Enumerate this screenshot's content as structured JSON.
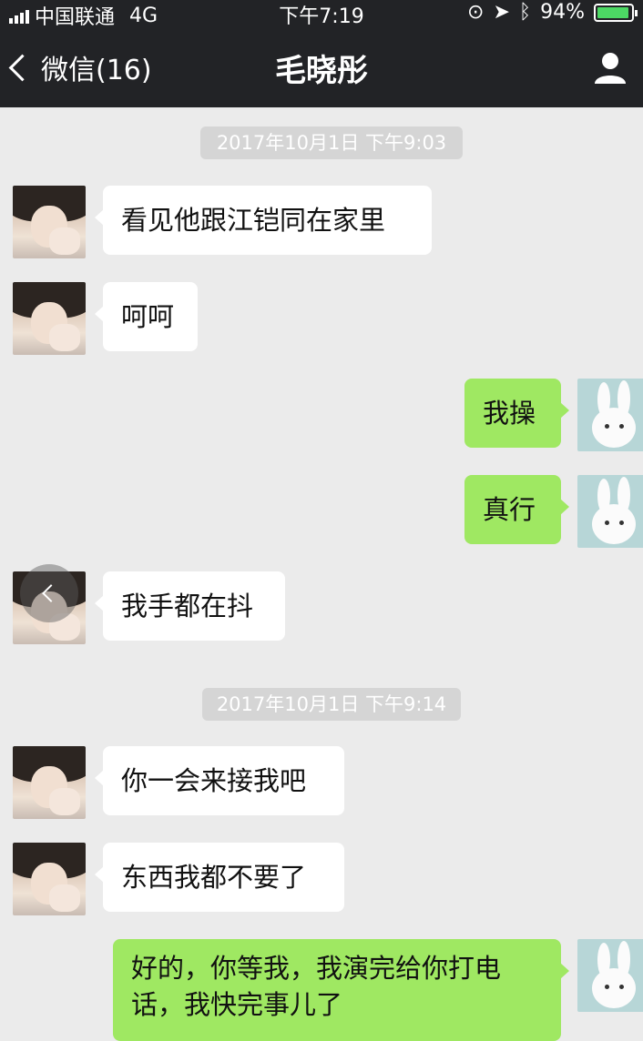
{
  "status_bar": {
    "carrier": "中国联通",
    "network": "4G",
    "time": "下午7:19",
    "battery_text": "94%",
    "battery_level": 0.94,
    "battery_color": "#4cd964"
  },
  "nav": {
    "back_label": "微信(16)",
    "title": "毛晓彤",
    "profile_icon": "person-icon"
  },
  "timestamps": [
    "2017年10月1日 下午9:03",
    "2017年10月1日 下午9:14"
  ],
  "messages": [
    {
      "sender": "contact",
      "text": "看见他跟江铠同在家里"
    },
    {
      "sender": "contact",
      "text": "呵呵"
    },
    {
      "sender": "me",
      "text": "我操"
    },
    {
      "sender": "me",
      "text": "真行"
    },
    {
      "sender": "contact",
      "text": "我手都在抖"
    },
    {
      "sender": "contact",
      "text": "你一会来接我吧"
    },
    {
      "sender": "contact",
      "text": "东西我都不要了"
    },
    {
      "sender": "me",
      "line1": "好的，你等我，我演完给你打电",
      "line2": "话，我快完事儿了"
    }
  ],
  "colors": {
    "nav_bg": "#222326",
    "chat_bg": "#ebebeb",
    "bubble_in": "#ffffff",
    "bubble_out": "#9fe862",
    "timestamp_bg": "#d5d5d5"
  }
}
